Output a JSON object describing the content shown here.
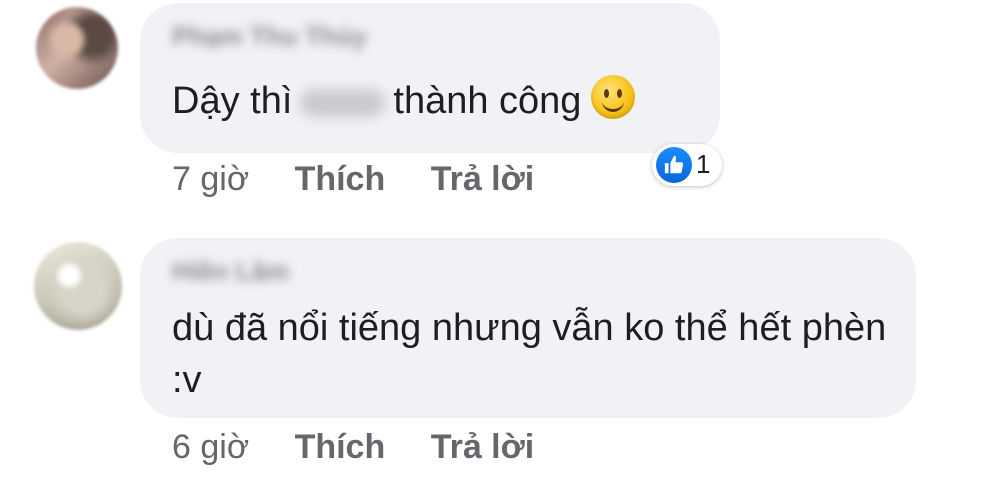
{
  "comments": [
    {
      "author": "Phạm Thu Thủy",
      "text_before": "Dậy thì",
      "text_after": "thành công",
      "time": "7 giờ",
      "like_label": "Thích",
      "reply_label": "Trả lời",
      "reaction_count": "1"
    },
    {
      "author": "Hiền Lâm",
      "text": "dù đã nổi tiếng nhưng vẫn ko thể hết phèn :v",
      "time": "6 giờ",
      "like_label": "Thích",
      "reply_label": "Trả lời"
    }
  ],
  "icons": {
    "reaction": "like-thumb-icon",
    "emoji": "slightly-smiling-face-icon"
  },
  "colors": {
    "bubble": "#f0f2f5",
    "like_blue": "#1877f2",
    "meta_text": "#65676b"
  }
}
